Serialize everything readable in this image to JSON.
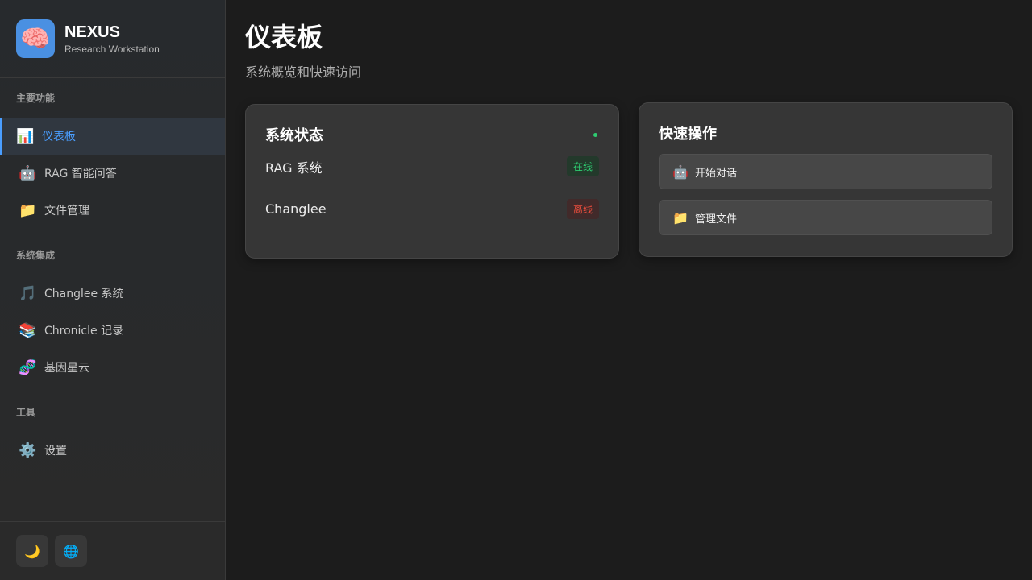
{
  "brand": {
    "logo_icon": "🧠",
    "name": "NEXUS",
    "subtitle": "Research Workstation",
    "accent": "#4a90e2"
  },
  "sidebar": {
    "sections": [
      {
        "title": "主要功能",
        "items": [
          {
            "icon": "📊",
            "label": "仪表板",
            "active": true
          },
          {
            "icon": "🤖",
            "label": "RAG 智能问答"
          },
          {
            "icon": "📁",
            "label": "文件管理"
          }
        ]
      },
      {
        "title": "系统集成",
        "items": [
          {
            "icon": "🎵",
            "label": "Changlee 系统"
          },
          {
            "icon": "📚",
            "label": "Chronicle 记录"
          },
          {
            "icon": "🧬",
            "label": "基因星云"
          }
        ]
      },
      {
        "title": "工具",
        "items": [
          {
            "icon": "⚙️",
            "label": "设置"
          }
        ]
      }
    ],
    "footer": {
      "theme_icon": "🌙",
      "language_icon": "🌐"
    }
  },
  "main": {
    "title": "仪表板",
    "subtitle": "系统概览和快速访问",
    "status_card": {
      "title": "系统状态",
      "indicator_color": "#2ecc71",
      "rows": [
        {
          "name": "RAG 系统",
          "status": "在线",
          "state": "online"
        },
        {
          "name": "Changlee",
          "status": "离线",
          "state": "offline"
        }
      ]
    },
    "quick_card": {
      "title": "快速操作",
      "actions": [
        {
          "icon": "🤖",
          "label": "开始对话"
        },
        {
          "icon": "📁",
          "label": "管理文件"
        }
      ]
    }
  },
  "colors": {
    "active": "#4a9eff",
    "online": "#2ecc71",
    "offline": "#e74c3c",
    "background": "#1c1c1c"
  }
}
